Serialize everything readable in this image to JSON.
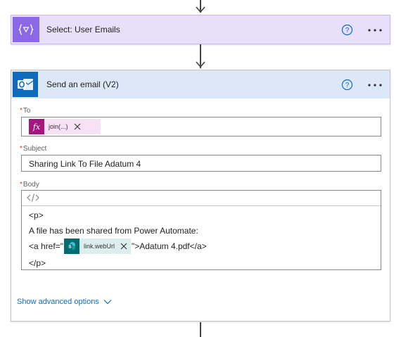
{
  "flow": {
    "select_card": {
      "title": "Select: User Emails",
      "icon": "data-operation-icon",
      "accent_color": "#8b69e6",
      "background": "#e8e0fb"
    },
    "email_card": {
      "title": "Send an email (V2)",
      "icon": "outlook-icon",
      "accent_color": "#0f6cbd",
      "header_background": "#dce8f8",
      "to": {
        "label": "To",
        "required_marker": "*",
        "token": {
          "label": "join(...)",
          "icon": "fx-icon",
          "color": "#a3177e"
        }
      },
      "subject": {
        "label": "Subject",
        "required_marker": "*",
        "value": "Sharing Link To File Adatum 4"
      },
      "body": {
        "label": "Body",
        "required_marker": "*",
        "code_view_icon": "code-view-icon",
        "lines": {
          "line1": "<p>",
          "line2": "A file has been shared from Power Automate:",
          "line3_prefix": "<a href=\"",
          "line3_token": {
            "label": "link.webUrl",
            "icon": "sharepoint-icon",
            "color": "#036c70"
          },
          "line3_suffix": "\">Adatum 4.pdf</a>",
          "line4": "</p>"
        }
      },
      "advanced_options_label": "Show advanced options"
    }
  }
}
